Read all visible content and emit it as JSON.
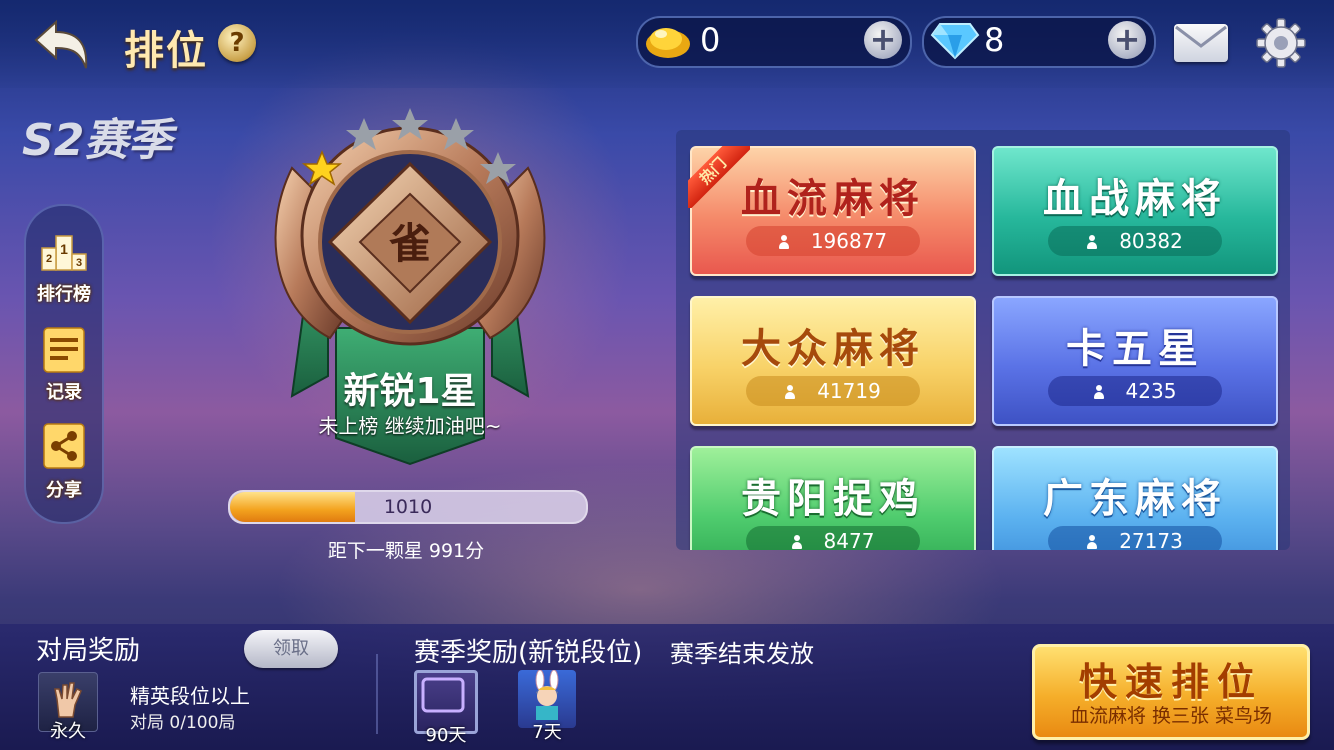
{
  "header": {
    "title": "排位",
    "help_label": "?",
    "gold": {
      "value": "0",
      "icon": "gold-ingot-icon"
    },
    "diamond": {
      "value": "8",
      "icon": "diamond-icon"
    },
    "plus_label": "+"
  },
  "season": {
    "label": "S2赛季"
  },
  "side_menu": [
    {
      "label": "排行榜",
      "icon": "podium-icon"
    },
    {
      "label": "记录",
      "icon": "record-list-icon"
    },
    {
      "label": "分享",
      "icon": "share-icon"
    }
  ],
  "podium_numbers": [
    "2",
    "1",
    "3"
  ],
  "badge": {
    "emblem_char": "雀",
    "rank_name": "新锐1星",
    "status": "未上榜 继续加油吧~",
    "filled_stars": 1,
    "total_stars": 5
  },
  "progress": {
    "score": "1010",
    "fraction": 0.35,
    "next_star_text": "距下一颗星 991分"
  },
  "modes": [
    {
      "name": "血流麻将",
      "count": "196877",
      "hot": true,
      "hot_label": "热门",
      "theme": "red"
    },
    {
      "name": "血战麻将",
      "count": "80382",
      "theme": "teal"
    },
    {
      "name": "大众麻将",
      "count": "41719",
      "theme": "gold"
    },
    {
      "name": "卡五星",
      "count": "4235",
      "theme": "blue"
    },
    {
      "name": "贵阳捉鸡",
      "count": "8477",
      "theme": "green"
    },
    {
      "name": "广东麻将",
      "count": "27173",
      "theme": "sky"
    }
  ],
  "match_reward": {
    "title": "对局奖励",
    "claim_label": "领取",
    "item_duration": "永久",
    "requirement": "精英段位以上",
    "progress_text": "对局 0/100局"
  },
  "season_reward": {
    "title": "赛季奖励(新锐段位)",
    "note": "赛季结束发放",
    "items": [
      {
        "duration": "90天"
      },
      {
        "duration": "7天"
      }
    ]
  },
  "quick_match": {
    "title": "快速排位",
    "subtitle": "血流麻将 换三张 菜鸟场"
  }
}
